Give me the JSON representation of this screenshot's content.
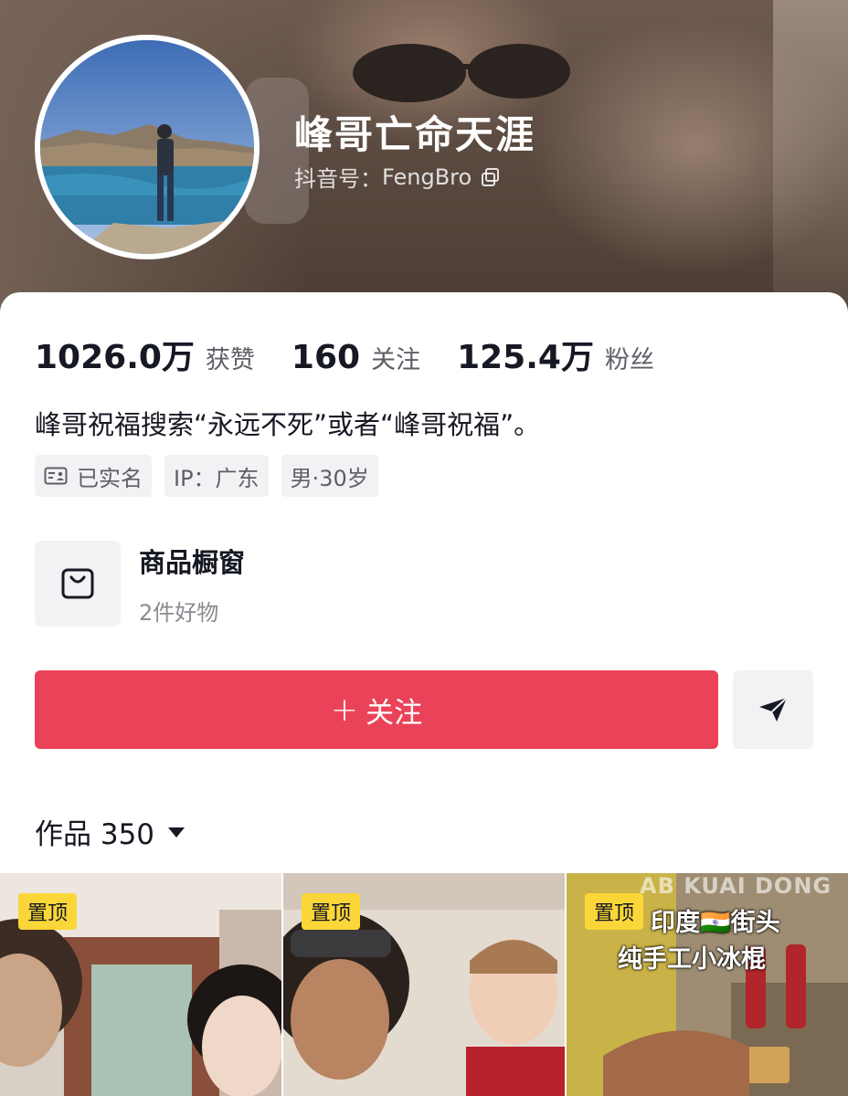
{
  "profile": {
    "name": "峰哥亡命天涯",
    "id_label": "抖音号：",
    "id_value": "FengBro"
  },
  "stats": [
    {
      "value": "1026.0万",
      "label": "获赞"
    },
    {
      "value": "160",
      "label": "关注"
    },
    {
      "value": "125.4万",
      "label": "粉丝"
    }
  ],
  "bio": "峰哥祝福搜索“永远不死”或者“峰哥祝福”。",
  "tags": {
    "verified": "已实名",
    "ip": "IP：广东",
    "gender_age": "男·30岁"
  },
  "shop": {
    "title": "商品橱窗",
    "subtitle": "2件好物"
  },
  "actions": {
    "follow_icon": "+",
    "follow_label": "关注"
  },
  "works": {
    "label": "作品 350"
  },
  "videos": [
    {
      "badge": "置顶"
    },
    {
      "badge": "置顶"
    },
    {
      "badge": "置顶",
      "watermark": "AB KUAI DONG",
      "caption_line1": "印度🇮🇳街头",
      "caption_line2": "纯手工小冰棍"
    }
  ],
  "colors": {
    "accent": "#ea4359",
    "pin_badge": "#fbd638",
    "text_primary": "#161823",
    "text_secondary": "#5d5f66"
  }
}
